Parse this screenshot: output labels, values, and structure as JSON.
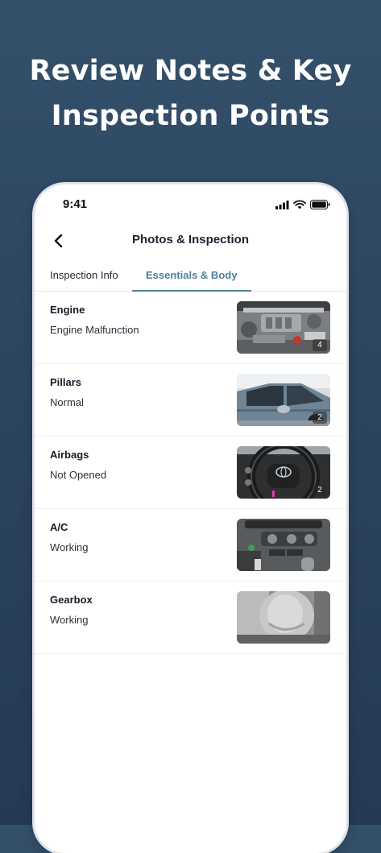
{
  "headline": {
    "line1": "Review Notes & Key",
    "line2": "Inspection Points"
  },
  "status_bar": {
    "time": "9:41"
  },
  "nav": {
    "title": "Photos & Inspection"
  },
  "tabs": [
    {
      "label": "Inspection Info",
      "active": false
    },
    {
      "label": "Essentials & Body",
      "active": true
    }
  ],
  "rows": [
    {
      "label": "Engine",
      "value": "Engine Malfunction",
      "photo_count": "4",
      "photo": "engine-photo"
    },
    {
      "label": "Pillars",
      "value": "Normal",
      "photo_count": "2",
      "photo": "car-side-photo"
    },
    {
      "label": "Airbags",
      "value": "Not Opened",
      "photo_count": "2",
      "photo": "steering-wheel-photo"
    },
    {
      "label": "A/C",
      "value": "Working",
      "photo_count": "",
      "photo": "ac-controls-photo"
    },
    {
      "label": "Gearbox",
      "value": "Working",
      "photo_count": "",
      "photo": "gear-shifter-photo"
    }
  ],
  "colors": {
    "accent": "#4f8299",
    "background": "#2c4560",
    "text": "#1c2230"
  }
}
